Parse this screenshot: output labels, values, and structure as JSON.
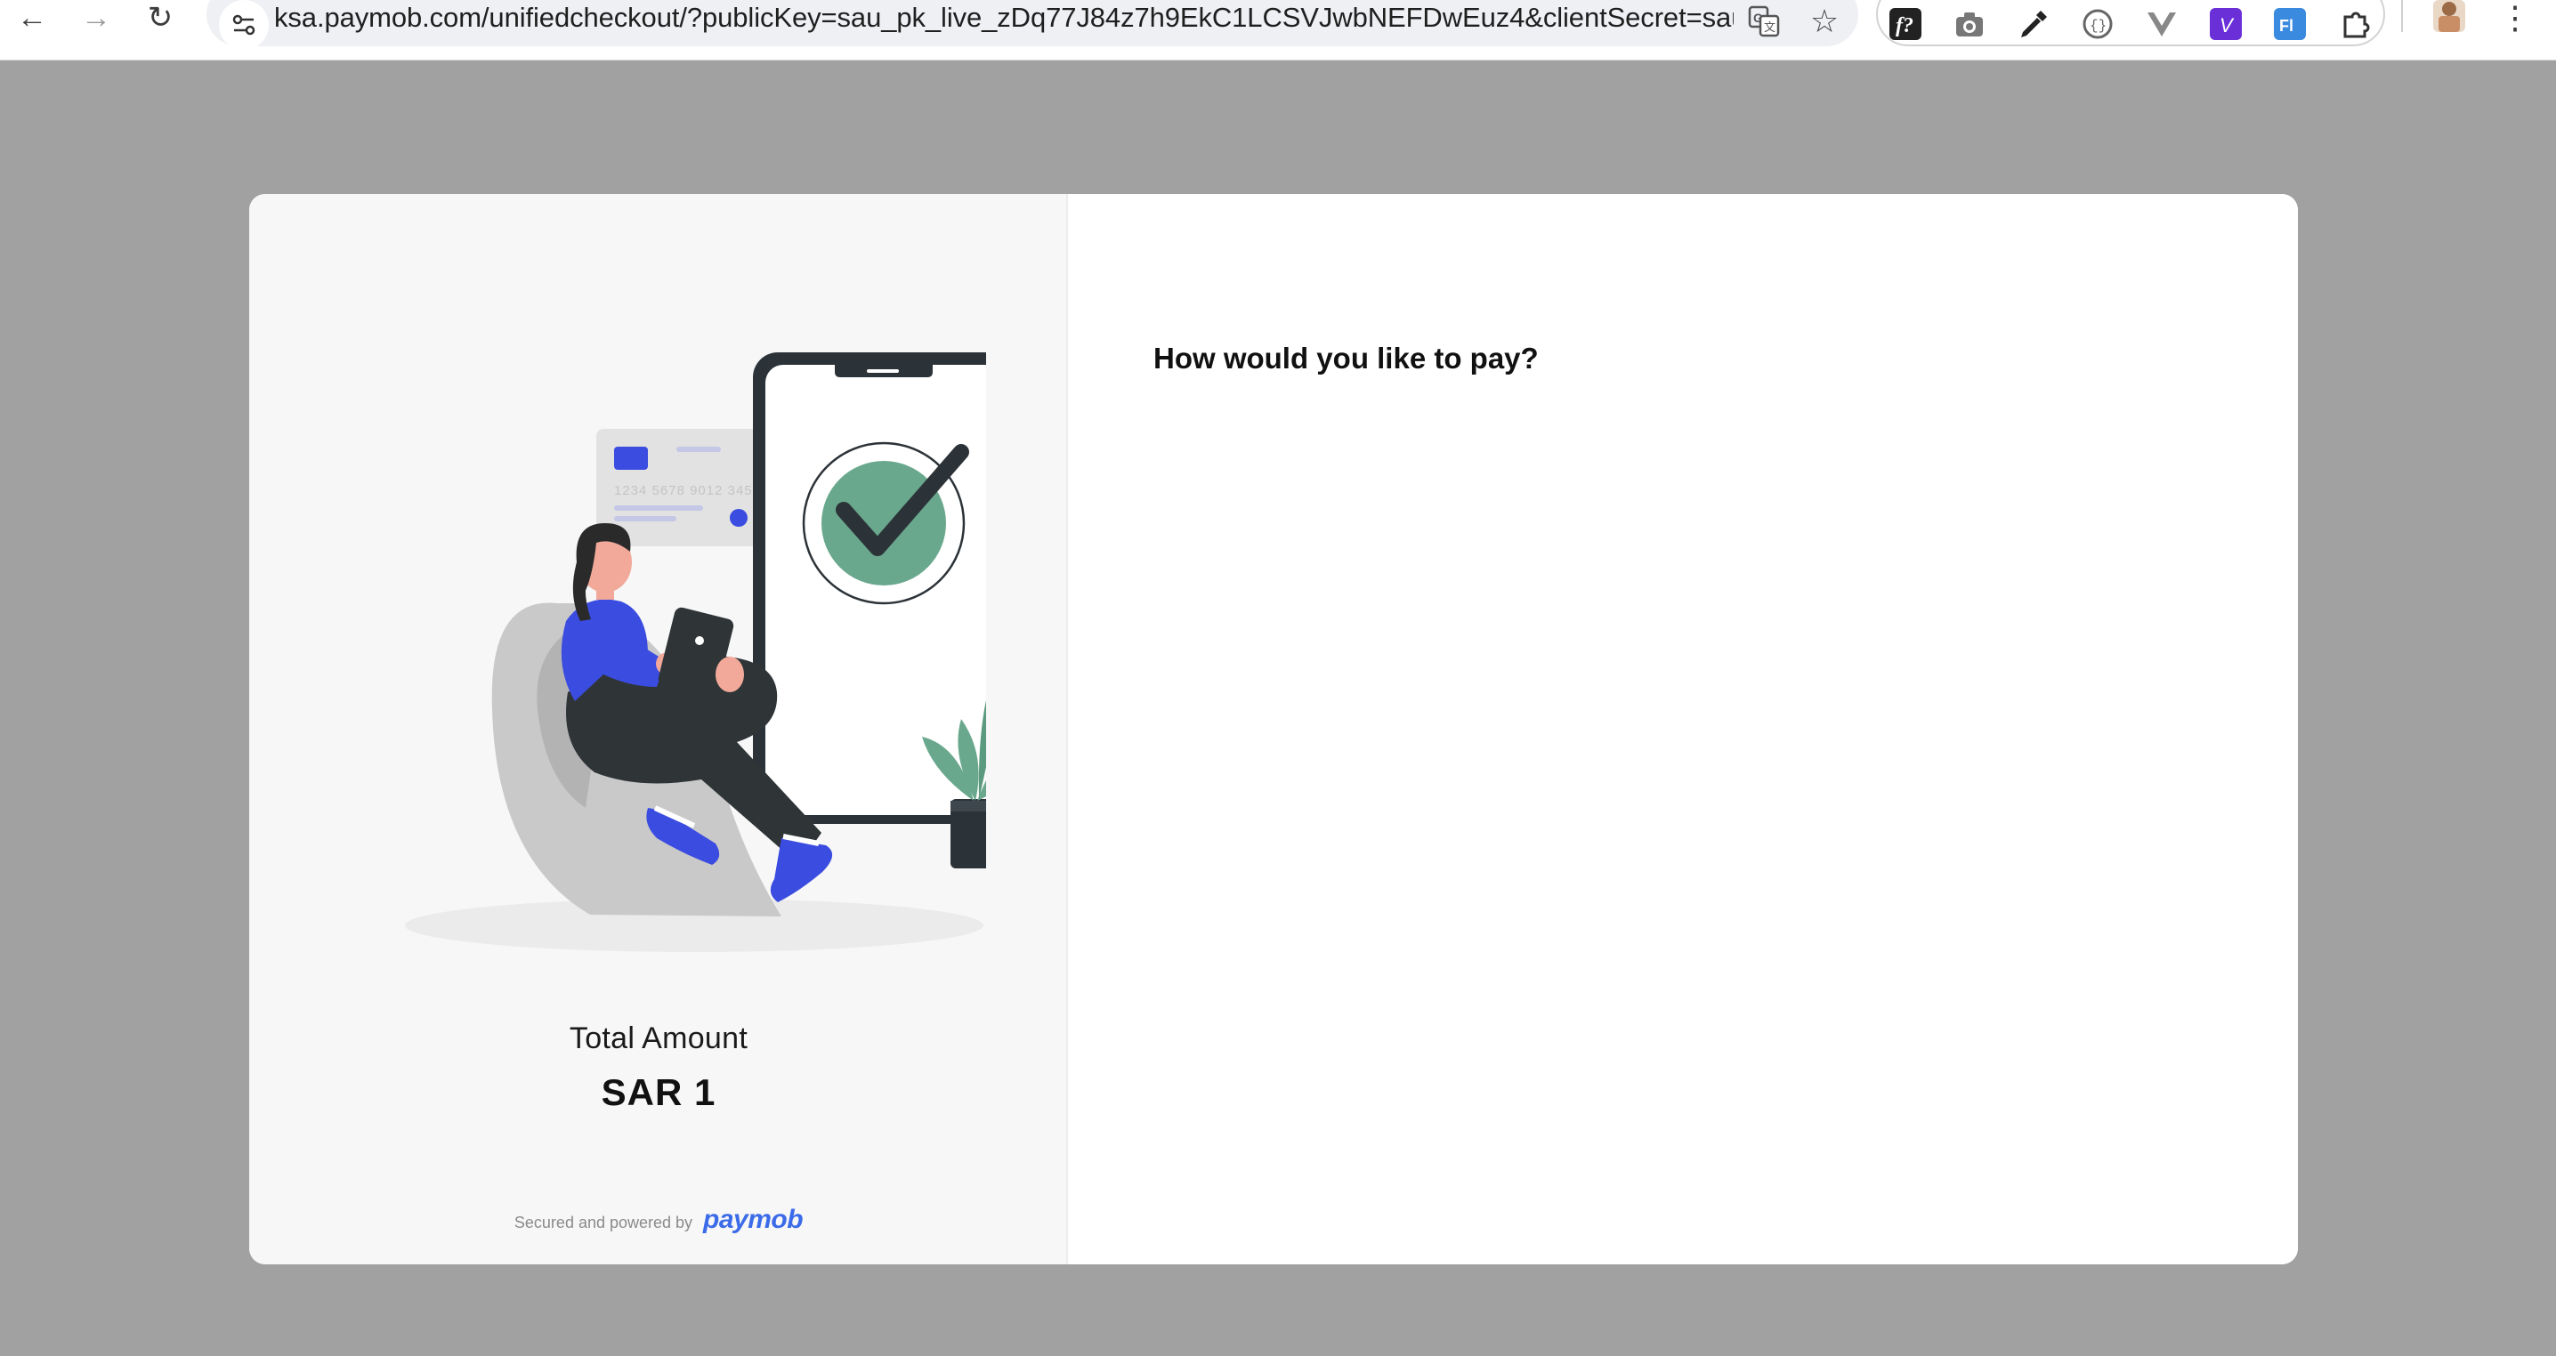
{
  "browser": {
    "url": "ksa.paymob.com/unifiedcheckout/?publicKey=sau_pk_live_zDq77J84z7h9EkC1LCSVJwbNEFDwEuz4&clientSecret=sau_c...",
    "nav": {
      "back": "←",
      "forward": "→",
      "reload": "↻"
    },
    "icons": [
      "translate-icon",
      "bookmark-star-icon"
    ],
    "extensions": [
      "fonts-extension-icon",
      "camera-extension-icon",
      "eyedropper-extension-icon",
      "code-extension-icon",
      "vue-extension-icon",
      "v-extension-icon",
      "fl-extension-icon",
      "puzzle-extension-icon"
    ],
    "menu": "⋮"
  },
  "checkout": {
    "heading": "How would you like to pay?",
    "total_label": "Total Amount",
    "total_amount": "SAR 1",
    "card_number": "1234 5678 9012 345",
    "powered_text": "Secured and powered by",
    "brand": "paymob"
  },
  "colors": {
    "backdrop": "#a1a1a1",
    "accent_blue": "#3b4ce0",
    "check_green": "#6aa88e",
    "brand_blue": "#3b6be8"
  }
}
